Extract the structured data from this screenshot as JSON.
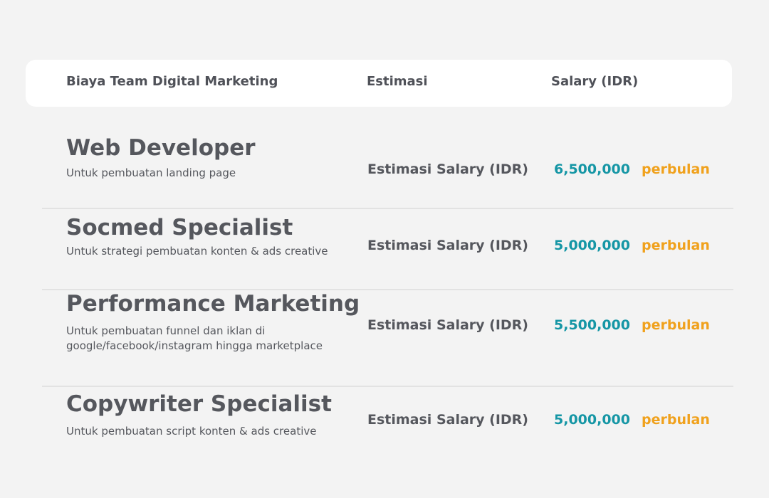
{
  "header": {
    "col_role": "Biaya Team Digital Marketing",
    "col_estimate": "Estimasi",
    "col_salary": "Salary (IDR)"
  },
  "rows": [
    {
      "title": "Web Developer",
      "description": "Untuk pembuatan landing page",
      "estimate_label": "Estimasi Salary (IDR)",
      "amount": "6,500,000",
      "period": "perbulan"
    },
    {
      "title": "Socmed Specialist",
      "description": "Untuk strategi pembuatan konten & ads creative",
      "estimate_label": "Estimasi Salary (IDR)",
      "amount": "5,000,000",
      "period": "perbulan"
    },
    {
      "title": "Performance Marketing",
      "description": "Untuk pembuatan funnel dan iklan di google/facebook/instagram hingga marketplace",
      "estimate_label": "Estimasi Salary (IDR)",
      "amount": "5,500,000",
      "period": "perbulan"
    },
    {
      "title": "Copywriter Specialist",
      "description": "Untuk pembuatan script konten & ads creative",
      "estimate_label": "Estimasi Salary (IDR)",
      "amount": "5,000,000",
      "period": "perbulan"
    }
  ],
  "colors": {
    "background": "#f3f3f3",
    "header_bg": "#ffffff",
    "text": "#55575d",
    "amount": "#1596a5",
    "period": "#f0a11c",
    "divider": "#e2e2e2"
  }
}
